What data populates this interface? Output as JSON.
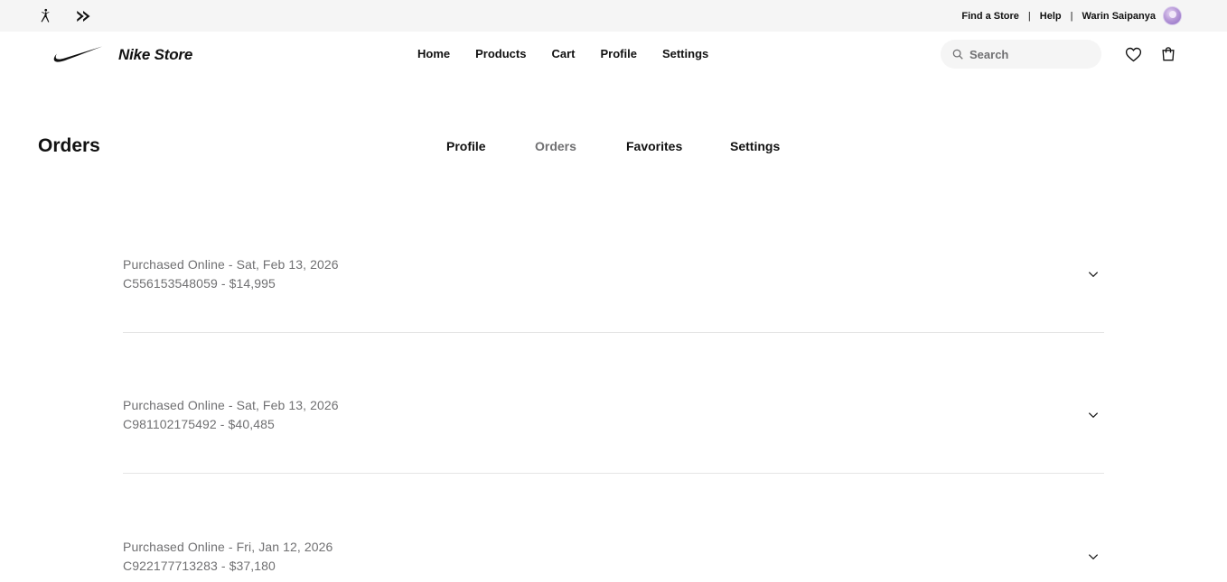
{
  "utility_bar": {
    "brand_icons": [
      "jordan-jumpman-icon",
      "converse-star-chevron-icon"
    ],
    "links": {
      "find_store": "Find a Store",
      "help": "Help",
      "user_name": "Warin Saipanya"
    },
    "separator": "|"
  },
  "header": {
    "logo_icon": "nike-swoosh-icon",
    "store_name": "Nike Store",
    "nav": {
      "home": "Home",
      "products": "Products",
      "cart": "Cart",
      "profile": "Profile",
      "settings": "Settings"
    },
    "search": {
      "placeholder": "Search",
      "value": ""
    },
    "icons": [
      "heart-icon",
      "shopping-bag-icon",
      "search-icon"
    ]
  },
  "page": {
    "title": "Orders",
    "sub_nav": {
      "profile": "Profile",
      "orders": "Orders",
      "favorites": "Favorites",
      "settings": "Settings",
      "active": "Orders"
    }
  },
  "orders": [
    {
      "line1": "Purchased Online - Sat, Feb 13, 2026",
      "line2": "C556153548059 - $14,995"
    },
    {
      "line1": "Purchased Online - Sat, Feb 13, 2026",
      "line2": "C981102175492 - $40,485"
    },
    {
      "line1": "Purchased Online - Fri, Jan 12, 2026",
      "line2": "C922177713283 - $37,180"
    }
  ],
  "colors": {
    "text_primary": "#111111",
    "text_secondary": "#707072",
    "utility_bg": "#f5f5f5",
    "divider": "#e5e5e5"
  }
}
